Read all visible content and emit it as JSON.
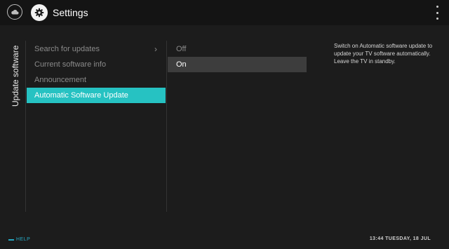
{
  "header": {
    "title": "Settings",
    "home_icon": "cloud-icon",
    "settings_icon": "gear-icon",
    "menu_icon": "vertical-dots-icon"
  },
  "section": {
    "label": "Update software"
  },
  "menu": {
    "items": [
      {
        "label": "Search for updates",
        "has_submenu": true
      },
      {
        "label": "Current software info"
      },
      {
        "label": "Announcement"
      },
      {
        "label": "Automatic Software Update",
        "active": true
      }
    ]
  },
  "options": {
    "items": [
      {
        "label": "Off"
      },
      {
        "label": "On",
        "selected": true
      }
    ]
  },
  "description": "Switch on Automatic software update to update your TV software automatically. Leave the TV in standby.",
  "footer": {
    "help_label": "HELP",
    "clock": "13:44 TUESDAY, 18 JUL"
  },
  "colors": {
    "accent": "#26c2c2",
    "background": "#1c1c1c",
    "help": "#26a8c2"
  }
}
